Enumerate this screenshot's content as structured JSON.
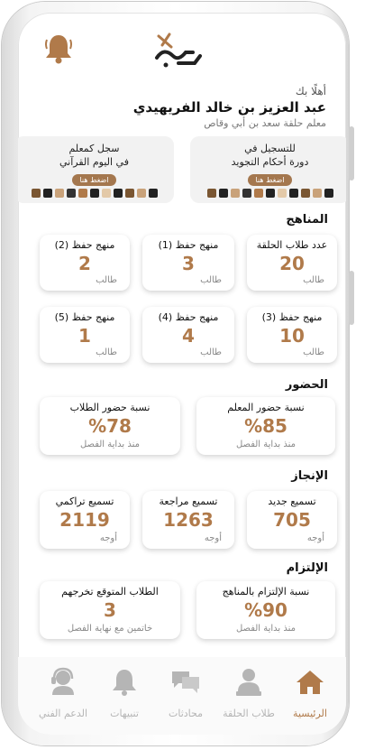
{
  "header": {
    "greeting": "أهلًا بك",
    "name": "عبد العزيز بن خالد الفريهيدي",
    "role": "معلم حلقة سعد بن أبي وقاص"
  },
  "banners": [
    {
      "line1": "للتسجيل في",
      "line2": "دورة أحكام التجويد",
      "button": "اضغط هنا"
    },
    {
      "line1": "سجل كمعلم",
      "line2": "في اليوم القرآني",
      "button": "اضغط هنا"
    }
  ],
  "sections": {
    "curricula": "المناهج",
    "attendance": "الحضور",
    "achievement": "الإنجاز",
    "commitment": "الإلتزام"
  },
  "curricula_cards": [
    {
      "label": "عدد طلاب الحلقة",
      "value": "20",
      "unit": "طالب"
    },
    {
      "label": "منهج حفظ (1)",
      "value": "3",
      "unit": "طالب"
    },
    {
      "label": "منهج حفظ (2)",
      "value": "2",
      "unit": "طالب"
    },
    {
      "label": "منهج حفظ (3)",
      "value": "10",
      "unit": "طالب"
    },
    {
      "label": "منهج حفظ (4)",
      "value": "4",
      "unit": "طالب"
    },
    {
      "label": "منهج حفظ (5)",
      "value": "1",
      "unit": "طالب"
    }
  ],
  "attendance_cards": [
    {
      "label": "نسبة حضور المعلم",
      "value": "%85",
      "unit": "منذ بداية الفصل"
    },
    {
      "label": "نسبة حضور الطلاب",
      "value": "%78",
      "unit": "منذ بداية الفصل"
    }
  ],
  "achievement_cards": [
    {
      "label": "تسميع جديد",
      "value": "705",
      "unit": "أوجه"
    },
    {
      "label": "تسميع مراجعة",
      "value": "1263",
      "unit": "أوجه"
    },
    {
      "label": "تسميع تراكمي",
      "value": "2119",
      "unit": "أوجه"
    }
  ],
  "commitment_cards": [
    {
      "label": "نسبة الإلتزام بالمناهج",
      "value": "%90",
      "unit": "منذ بداية الفصل"
    },
    {
      "label": "الطلاب المتوقع تخرجهم",
      "value": "3",
      "unit": "خاتمين مع نهاية الفصل"
    }
  ],
  "nav": [
    {
      "label": "الرئيسية",
      "icon": "home-icon"
    },
    {
      "label": "طلاب الحلقة",
      "icon": "student-icon"
    },
    {
      "label": "محادثات",
      "icon": "chat-icon"
    },
    {
      "label": "تنبيهات",
      "icon": "bell-icon"
    },
    {
      "label": "الدعم الفني",
      "icon": "support-icon"
    }
  ],
  "colors": {
    "accent": "#b07a4a",
    "inactive": "#b5b5b5"
  }
}
